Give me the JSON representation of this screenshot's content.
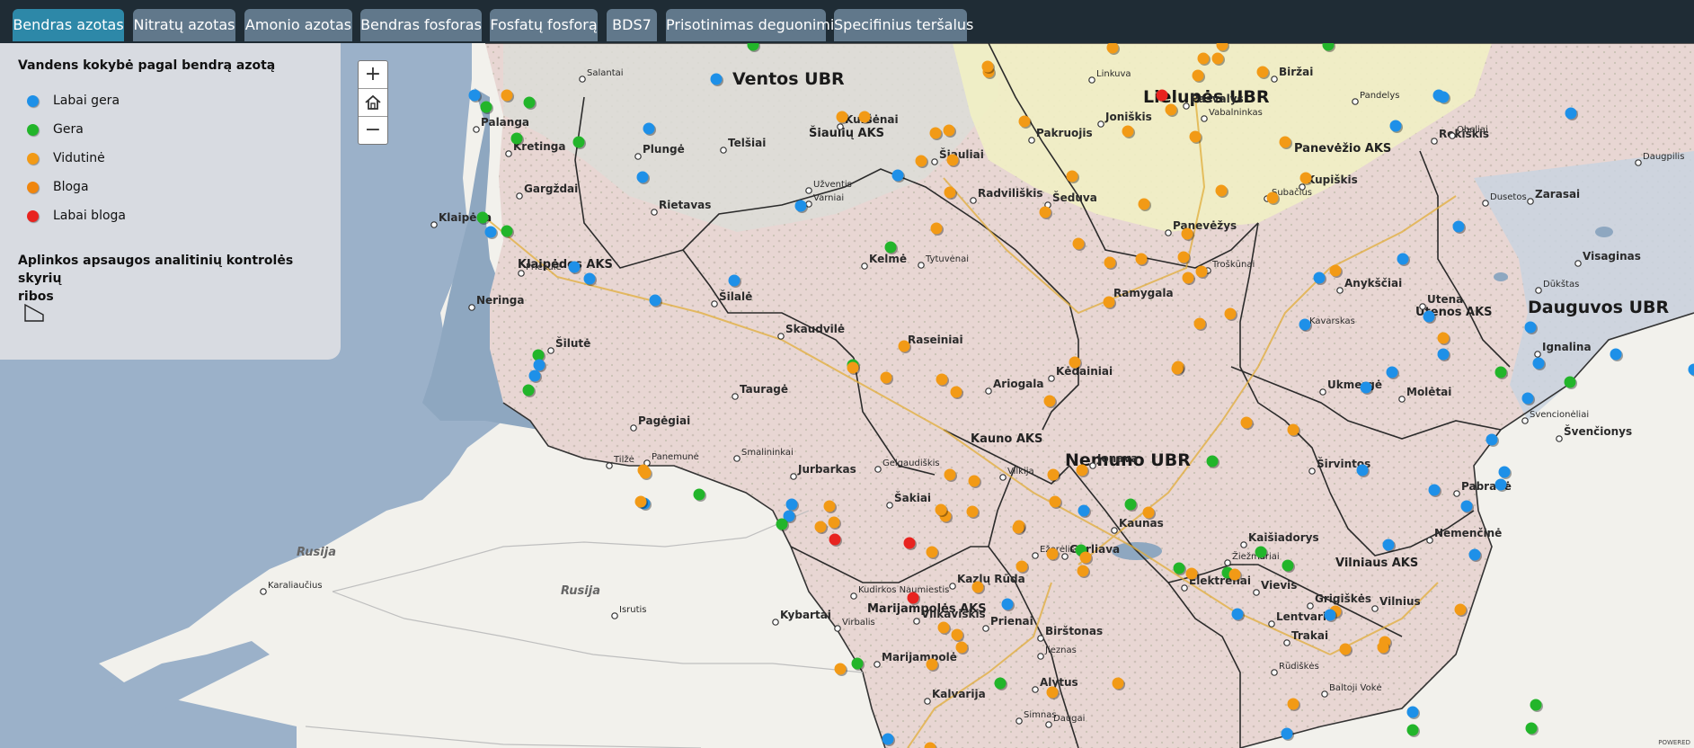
{
  "tabs": [
    {
      "label": "Bendras azotas",
      "active": true
    },
    {
      "label": "Nitratų azotas",
      "active": false
    },
    {
      "label": "Amonio azotas",
      "active": false
    },
    {
      "label": "Bendras fosforas",
      "active": false
    },
    {
      "label": "Fosfatų fosforą",
      "active": false
    },
    {
      "label": "BDS7",
      "active": false
    },
    {
      "label": "Prisotinimas deguonimi",
      "active": false
    },
    {
      "label": "Specifinius teršalus",
      "active": false
    }
  ],
  "legend": {
    "title": "Vandens kokybė pagal bendrą azotą",
    "items": [
      {
        "label": "Labai gera",
        "color": "#1e90e8"
      },
      {
        "label": "Gera",
        "color": "#22b52a"
      },
      {
        "label": "Vidutinė",
        "color": "#f29a16"
      },
      {
        "label": "Bloga",
        "color": "#f0860e"
      },
      {
        "label": "Labai bloga",
        "color": "#e8231f"
      }
    ],
    "boundary_title_line1": "Aplinkos apsaugos analitinių kontrolės skyrių",
    "boundary_title_line2": "ribos",
    "boundary_icon": "polygon-outline-icon"
  },
  "zoom": {
    "in": "+",
    "home_icon": "home-icon",
    "out": "−"
  },
  "attribution": "POWERED",
  "map": {
    "basin_labels": [
      "Ventos UBR",
      "Lielupės UBR",
      "Nemuno UBR",
      "Dauguvos UBR"
    ],
    "aks_labels": [
      "Šiaulių AKS",
      "Panevėžio AKS",
      "Klaipėdos AKS",
      "Utenos AKS",
      "Kauno AKS",
      "Marijampolės AKS",
      "Vilniaus AKS"
    ],
    "cities": [
      "Klaipėda",
      "Palanga",
      "Kretinga",
      "Gargždai",
      "Plungė",
      "Telšiai",
      "Šiauliai",
      "Kuršėnai",
      "Radviliškis",
      "Pakruojis",
      "Pasvalys",
      "Joniškis",
      "Biržai",
      "Rokiškis",
      "Kupiškis",
      "Panevėžys",
      "Zarasai",
      "Visaginas",
      "Anykščiai",
      "Utena",
      "Ignalina",
      "Molėtai",
      "Švenčionys",
      "Ukmergė",
      "Kėdainiai",
      "Jonava",
      "Kaunas",
      "Raseiniai",
      "Kelmė",
      "Tauragė",
      "Šilalė",
      "Šilutė",
      "Rietavas",
      "Jurbarkas",
      "Šakiai",
      "Kazlų Rūda",
      "Vilkaviškis",
      "Marijampolė",
      "Kalvarija",
      "Alytus",
      "Prienai",
      "Birštonas",
      "Trakai",
      "Vilnius",
      "Elektrėnai",
      "Kaišiadorys",
      "Širvintos",
      "Pabradė",
      "Nemenčinė",
      "Lentvaris",
      "Grigiškės",
      "Vievis",
      "Garliava",
      "Kybartai",
      "Pagėgiai",
      "Neringa",
      "Ariogala",
      "Šeduva",
      "Ramygala",
      "Skaudvilė",
      "Kavarskas",
      "Dusetos",
      "Obeliai",
      "Daugpilis",
      "Dūkštas",
      "Svencionėliai",
      "Žiežmariai",
      "Rūdiškės",
      "Tilžė",
      "Karaliaučius",
      "Isrutis",
      "Virbalis",
      "Kudirkos Naumiestis",
      "Ežerėlis",
      "Jieznas",
      "Simnas",
      "Daugai",
      "Baltoji Vokė",
      "Smalininkai",
      "Salantai",
      "Priekulė",
      "Varniai",
      "Užventis",
      "Tytuvėnai",
      "Gelgaudiškis",
      "Vilkija",
      "Linkuva",
      "Vabalninkas",
      "Pandelys",
      "Subačius",
      "Troškūnai",
      "Panemunė"
    ],
    "country_labels": [
      "Rusija",
      "Rusija"
    ]
  }
}
